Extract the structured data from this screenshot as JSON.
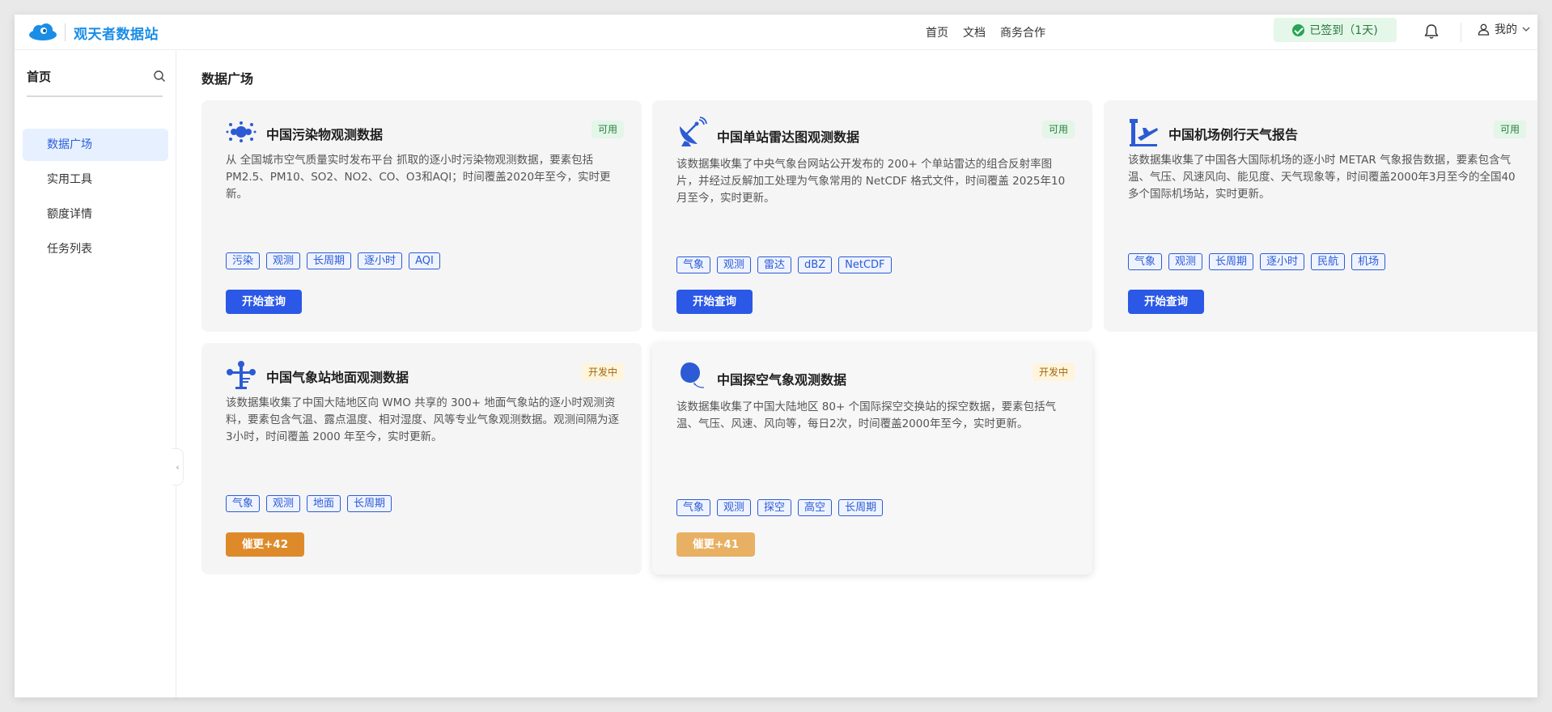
{
  "header": {
    "brand": "观天者数据站",
    "nav": [
      "首页",
      "文档",
      "商务合作"
    ],
    "signed_label": "已签到（1天)",
    "user_label": "我的"
  },
  "sidebar": {
    "title": "首页",
    "items": [
      {
        "label": "数据广场",
        "active": true
      },
      {
        "label": "实用工具",
        "active": false
      },
      {
        "label": "额度详情",
        "active": false
      },
      {
        "label": "任务列表",
        "active": false
      }
    ]
  },
  "main": {
    "title": "数据广场",
    "cards": [
      {
        "title": "中国污染物观测数据",
        "status": "可用",
        "description": "从 全国城市空气质量实时发布平台 抓取的逐小时污染物观测数据，要素包括PM2.5、PM10、SO2、NO2、CO、O3和AQI；时间覆盖2020年至今，实时更新。",
        "tags": [
          "污染",
          "观测",
          "长周期",
          "逐小时",
          "AQI"
        ],
        "button": "开始查询",
        "icon": "pollutant-icon"
      },
      {
        "title": "中国单站雷达图观测数据",
        "status": "可用",
        "description": "该数据集收集了中央气象台网站公开发布的 200+ 个单站雷达的组合反射率图片，并经过反解加工处理为气象常用的 NetCDF 格式文件，时间覆盖 2025年10月至今，实时更新。",
        "tags": [
          "气象",
          "观测",
          "雷达",
          "dBZ",
          "NetCDF"
        ],
        "button": "开始查询",
        "icon": "radar-dish-icon"
      },
      {
        "title": "中国机场例行天气报告",
        "status": "可用",
        "description": "该数据集收集了中国各大国际机场的逐小时 METAR 气象报告数据，要素包含气温、气压、风速风向、能见度、天气现象等，时间覆盖2000年3月至今的全国40多个国际机场站，实时更新。",
        "tags": [
          "气象",
          "观测",
          "长周期",
          "逐小时",
          "民航",
          "机场"
        ],
        "button": "开始查询",
        "icon": "airport-icon"
      },
      {
        "title": "中国气象站地面观测数据",
        "status": "开发中",
        "description": "该数据集收集了中国大陆地区向 WMO 共享的 300+ 地面气象站的逐小时观测资料，要素包含气温、露点温度、相对湿度、风等专业气象观测数据。观测间隔为逐3小时，时间覆盖 2000 年至今，实时更新。",
        "tags": [
          "气象",
          "观测",
          "地面",
          "长周期"
        ],
        "button": "催更+42",
        "icon": "weather-station-icon"
      },
      {
        "title": "中国探空气象观测数据",
        "status": "开发中",
        "description": "该数据集收集了中国大陆地区 80+ 个国际探空交换站的探空数据，要素包括气温、气压、风速、风向等，每日2次，时间覆盖2000年至今，实时更新。",
        "tags": [
          "气象",
          "观测",
          "探空",
          "高空",
          "长周期"
        ],
        "button": "催更+41",
        "icon": "balloon-icon"
      }
    ]
  },
  "colors": {
    "primary": "#2b58e6",
    "accent_blue": "#1a8de6",
    "available_bg": "#e3f6e8",
    "developing_bg": "#fff4dc",
    "urge_button": "#de8a2a"
  }
}
